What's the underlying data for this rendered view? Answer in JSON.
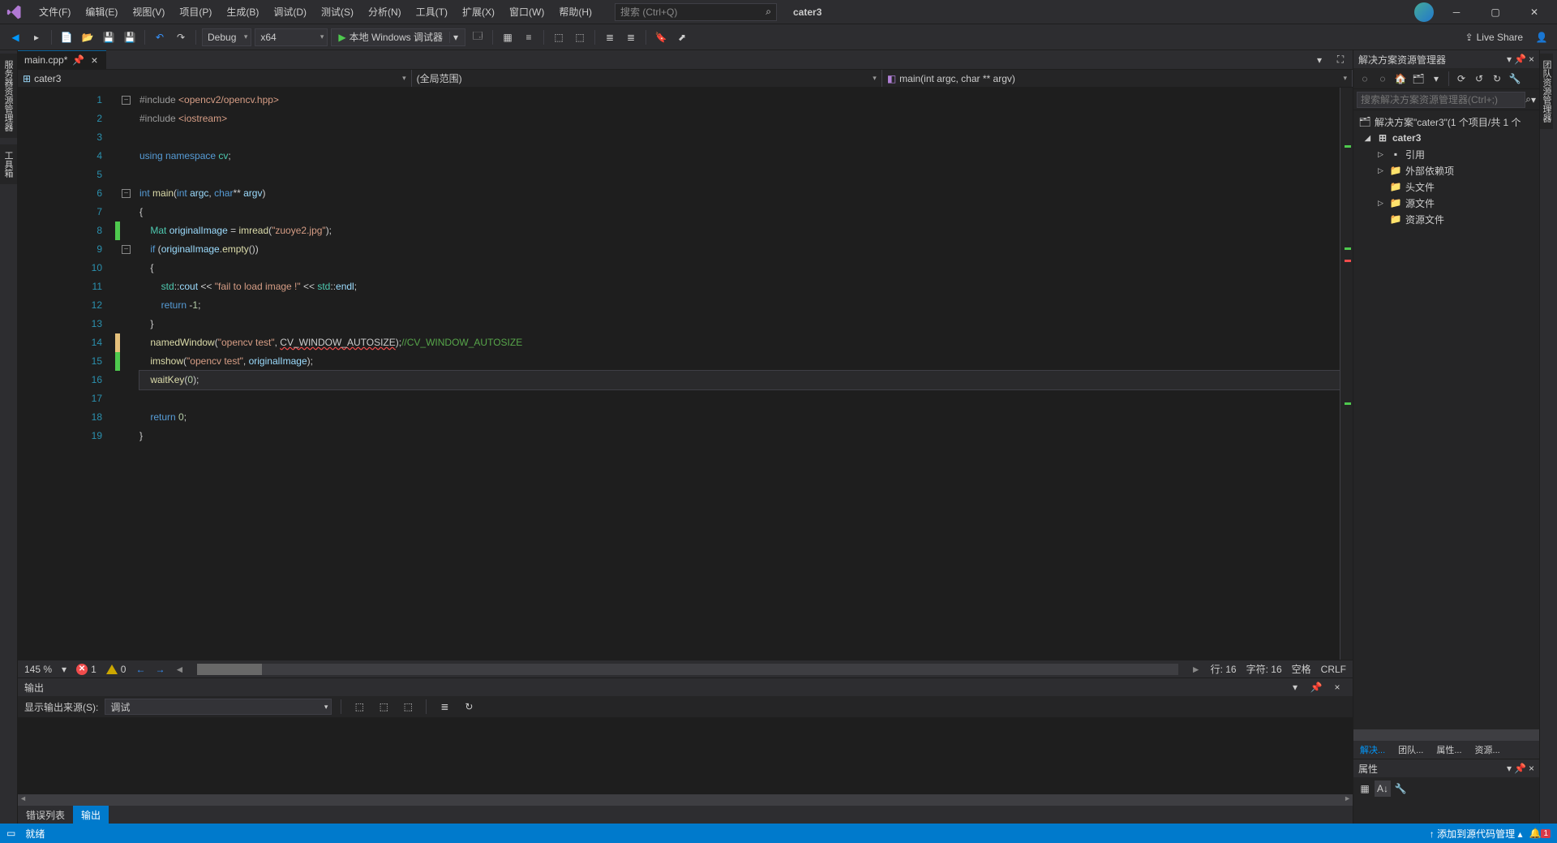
{
  "title_bar": {
    "project": "cater3",
    "search_placeholder": "搜索 (Ctrl+Q)"
  },
  "menu": {
    "file": "文件(F)",
    "edit": "编辑(E)",
    "view": "视图(V)",
    "project": "项目(P)",
    "build": "生成(B)",
    "debug": "调试(D)",
    "test": "测试(S)",
    "analyze": "分析(N)",
    "tools": "工具(T)",
    "extensions": "扩展(X)",
    "window": "窗口(W)",
    "help": "帮助(H)"
  },
  "toolbar": {
    "config": "Debug",
    "platform": "x64",
    "debug_label": "本地 Windows 调试器",
    "liveshare": "Live Share"
  },
  "left_rail": {
    "t1": "服务器资源管理器",
    "t2": "工具箱"
  },
  "right_rail": {
    "t1": "团队资源管理器"
  },
  "file_tabs": {
    "name": "main.cpp*"
  },
  "nav": {
    "scope1_icon": "⊞",
    "scope1": "cater3",
    "scope2": "(全局范围)",
    "scope3_icon": "◧",
    "scope3": "main(int argc, char ** argv)"
  },
  "code": {
    "lines": [
      {
        "n": 1,
        "fold": "-",
        "html": "<span class='pp'>#include</span> <span class='str'>&lt;opencv2/opencv.hpp&gt;</span>"
      },
      {
        "n": 2,
        "html": "<span class='pp'>#include</span> <span class='str'>&lt;iostream&gt;</span>"
      },
      {
        "n": 3,
        "html": ""
      },
      {
        "n": 4,
        "html": "<span class='kw'>using</span> <span class='kw'>namespace</span> <span class='type'>cv</span>;"
      },
      {
        "n": 5,
        "html": ""
      },
      {
        "n": 6,
        "fold": "-",
        "html": "<span class='kw'>int</span> <span class='func'>main</span>(<span class='kw'>int</span> <span class='var'>argc</span>, <span class='kw'>char</span>** <span class='var'>argv</span>)"
      },
      {
        "n": 7,
        "html": "{"
      },
      {
        "n": 8,
        "change": "green",
        "html": "    <span class='type'>Mat</span> <span class='var'>originalImage</span> = <span class='func'>imread</span>(<span class='str'>\"zuoye2.jpg\"</span>);"
      },
      {
        "n": 9,
        "fold": "-",
        "html": "    <span class='kw'>if</span> (<span class='var'>originalImage</span>.<span class='func'>empty</span>())"
      },
      {
        "n": 10,
        "html": "    {"
      },
      {
        "n": 11,
        "html": "        <span class='type'>std</span>::<span class='var'>cout</span> &lt;&lt; <span class='str'>\"fail to load image !\"</span> &lt;&lt; <span class='type'>std</span>::<span class='var'>endl</span>;"
      },
      {
        "n": 12,
        "html": "        <span class='kw'>return</span> -<span class='num'>1</span>;"
      },
      {
        "n": 13,
        "html": "    }"
      },
      {
        "n": 14,
        "change": "yellow",
        "html": "    <span class='func'>namedWindow</span>(<span class='str'>\"opencv test\"</span>, <span class='underline-red'>CV_WINDOW_AUTOSIZE</span>);<span class='cmt'>//CV_WINDOW_AUTOSIZE</span>"
      },
      {
        "n": 15,
        "change": "green",
        "html": "    <span class='func'>imshow</span>(<span class='str'>\"opencv test\"</span>, <span class='var'>originalImage</span>);"
      },
      {
        "n": 16,
        "current": true,
        "html": "    <span class='func'>waitKey</span>(<span class='num'>0</span>);"
      },
      {
        "n": 17,
        "html": ""
      },
      {
        "n": 18,
        "html": "    <span class='kw'>return</span> <span class='num'>0</span>;"
      },
      {
        "n": 19,
        "html": "}"
      }
    ]
  },
  "editor_status": {
    "zoom": "145 %",
    "errors": "1",
    "warnings": "0",
    "line": "行: 16",
    "col": "字符: 16",
    "spaces": "空格",
    "lineend": "CRLF"
  },
  "output": {
    "title": "输出",
    "source_label": "显示输出来源(S):",
    "source_value": "调试",
    "tabs": {
      "errlist": "错误列表",
      "output": "输出"
    }
  },
  "solution": {
    "title": "解决方案资源管理器",
    "search_placeholder": "搜索解决方案资源管理器(Ctrl+;)",
    "root": "解决方案\"cater3\"(1 个项目/共 1 个",
    "project": "cater3",
    "refs": "引用",
    "external": "外部依赖项",
    "headers": "头文件",
    "sources": "源文件",
    "resources": "资源文件",
    "tabs": {
      "sol": "解决...",
      "team": "团队...",
      "props": "属性...",
      "res": "资源..."
    }
  },
  "properties": {
    "title": "属性"
  },
  "status_bar": {
    "ready": "就绪",
    "source_ctrl": "↑ 添加到源代码管理 ▴",
    "notif_count": "1"
  }
}
